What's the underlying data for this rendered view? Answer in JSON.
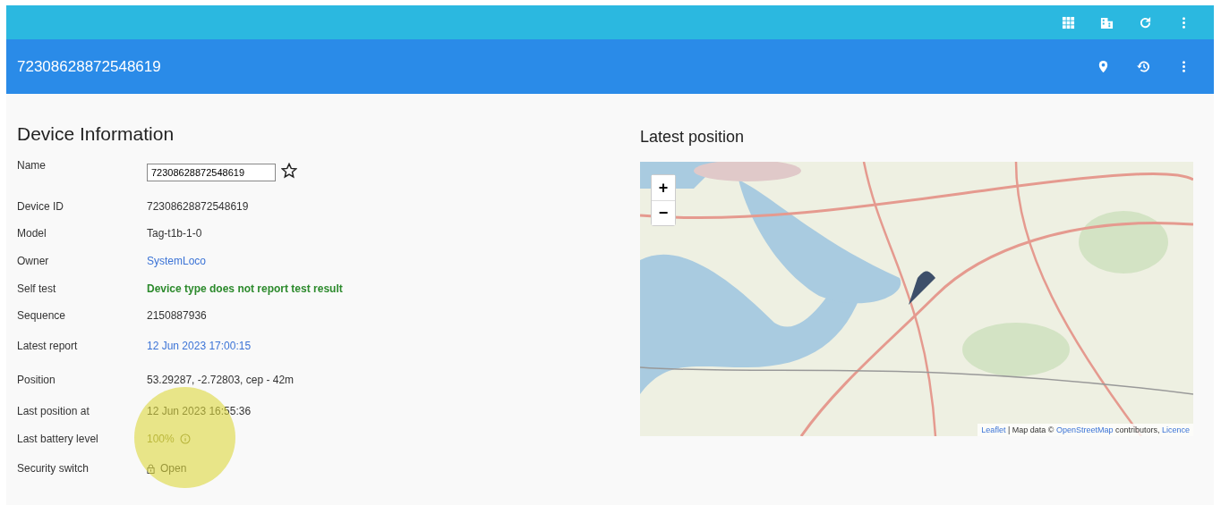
{
  "title_bar": {
    "title": "72308628872548619"
  },
  "device_info": {
    "heading": "Device Information",
    "rows": [
      {
        "label": "Name",
        "kind": "field",
        "value": "72308628872548619",
        "starred": false
      },
      {
        "label": "Device ID",
        "kind": "text",
        "value": "72308628872548619"
      },
      {
        "label": "Model",
        "kind": "text",
        "value": "Tag-t1b-1-0"
      },
      {
        "label": "Owner",
        "kind": "link",
        "value": "SystemLoco"
      },
      {
        "label": "Self test",
        "kind": "success",
        "value": "Device type does not report test result"
      },
      {
        "label": "Sequence",
        "kind": "text",
        "value": "2150887936"
      },
      {
        "label": "Latest report",
        "kind": "link",
        "value": "12 Jun 2023 17:00:15"
      },
      {
        "label": "Position",
        "kind": "text",
        "value": "53.29287, -2.72803, cep - 42m"
      },
      {
        "label": "Last position at",
        "kind": "text",
        "value": "12 Jun 2023 16:55:36"
      },
      {
        "label": "Last battery level",
        "kind": "info",
        "value": "100%"
      },
      {
        "label": "Security switch",
        "kind": "lock",
        "value": "Open"
      }
    ]
  },
  "latest_position": {
    "heading": "Latest position",
    "zoom_in": "+",
    "zoom_out": "−",
    "attribution": [
      {
        "text": "Leaflet",
        "link": true
      },
      {
        "text": " | Map data © ",
        "link": false
      },
      {
        "text": "OpenStreetMap",
        "link": true
      },
      {
        "text": " contributors, ",
        "link": false
      },
      {
        "text": "Licence",
        "link": true
      }
    ]
  }
}
